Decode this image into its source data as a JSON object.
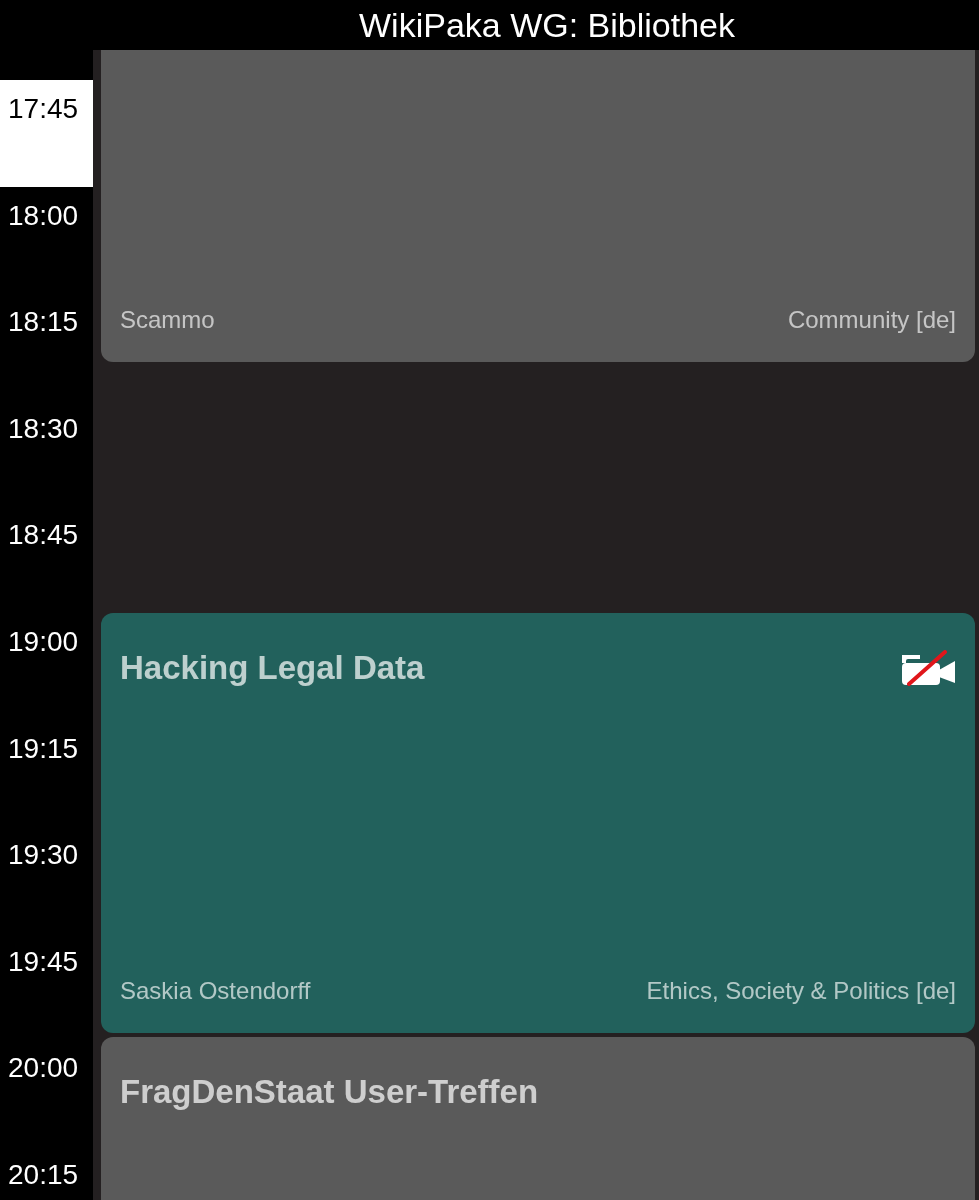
{
  "header": {
    "title": "WikiPaka WG: Bibliothek"
  },
  "time_slots": [
    {
      "label": "17:45",
      "current": true
    },
    {
      "label": "18:00",
      "current": false
    },
    {
      "label": "18:15",
      "current": false
    },
    {
      "label": "18:30",
      "current": false
    },
    {
      "label": "18:45",
      "current": false
    },
    {
      "label": "19:00",
      "current": false
    },
    {
      "label": "19:15",
      "current": false
    },
    {
      "label": "19:30",
      "current": false
    },
    {
      "label": "19:45",
      "current": false
    },
    {
      "label": "20:00",
      "current": false
    },
    {
      "label": "20:15",
      "current": false
    }
  ],
  "events": [
    {
      "speaker": "Scammo",
      "track": "Community [de]",
      "color": "#5a5a5a",
      "no_recording": false
    },
    {
      "title": "Hacking Legal Data",
      "speaker": "Saskia Ostendorff",
      "track": "Ethics, Society & Politics [de]",
      "color": "#22615c",
      "no_recording": true
    },
    {
      "title": "FragDenStaat User-Treffen",
      "color": "#5a5a5a",
      "no_recording": false
    }
  ]
}
